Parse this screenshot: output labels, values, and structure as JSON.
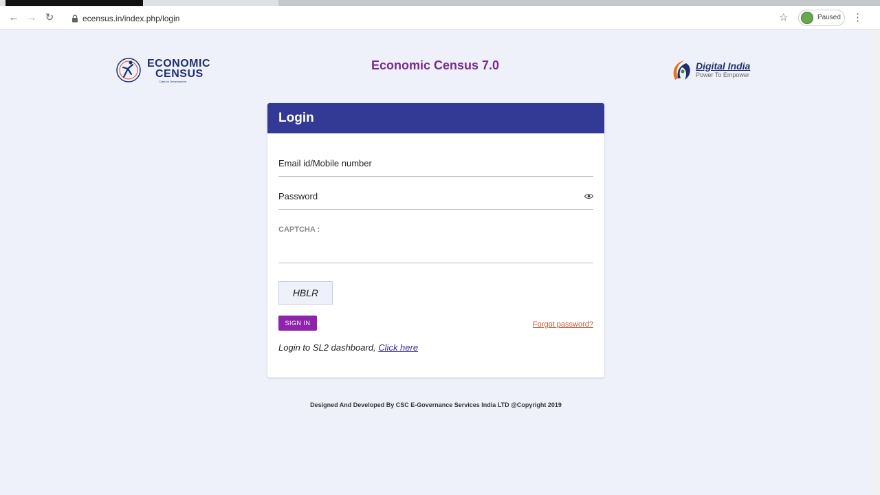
{
  "browser": {
    "url": "ecensus.in/index.php/login",
    "profile_status": "Paused",
    "back_icon": "back-arrow-icon",
    "forward_icon": "forward-arrow-icon",
    "reload_icon": "reload-icon"
  },
  "header": {
    "left_logo_line1": "ECONOMIC",
    "left_logo_line2": "CENSUS",
    "left_logo_tagline": "Data for Development",
    "title": "Economic Census 7.0",
    "right_logo_title": "Digital India",
    "right_logo_subtitle": "Power To Empower"
  },
  "login": {
    "title": "Login",
    "email_placeholder": "Email id/Mobile number",
    "password_placeholder": "Password",
    "captcha_label": "CAPTCHA :",
    "captcha_value": "HBLR",
    "signin_label": "SIGN IN",
    "forgot_label": "Forgot password?",
    "sl2_text": "Login to SL2 dashboard, ",
    "sl2_link": "Click here"
  },
  "footer": {
    "text": "Designed And Developed By CSC E-Governance Services India LTD @Copyright 2019"
  },
  "colors": {
    "header_bar": "#323a96",
    "title": "#7b2a8a",
    "signin": "#8e24aa",
    "page_bg": "#eef1fa"
  }
}
